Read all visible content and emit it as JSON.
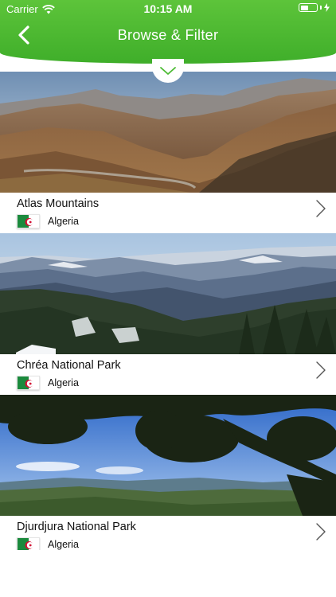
{
  "status_bar": {
    "carrier": "Carrier",
    "time": "10:15 AM"
  },
  "nav": {
    "title": "Browse & Filter",
    "back_icon": "chevron-left-icon"
  },
  "filter_toggle_icon": "chevron-down-icon",
  "theme": {
    "header_green": "#4cbb33",
    "text": "#111111"
  },
  "places": [
    {
      "name": "Atlas Mountains",
      "country": "Algeria"
    },
    {
      "name": "Chréa National Park",
      "country": "Algeria"
    },
    {
      "name": "Djurdjura National Park",
      "country": "Algeria"
    }
  ]
}
